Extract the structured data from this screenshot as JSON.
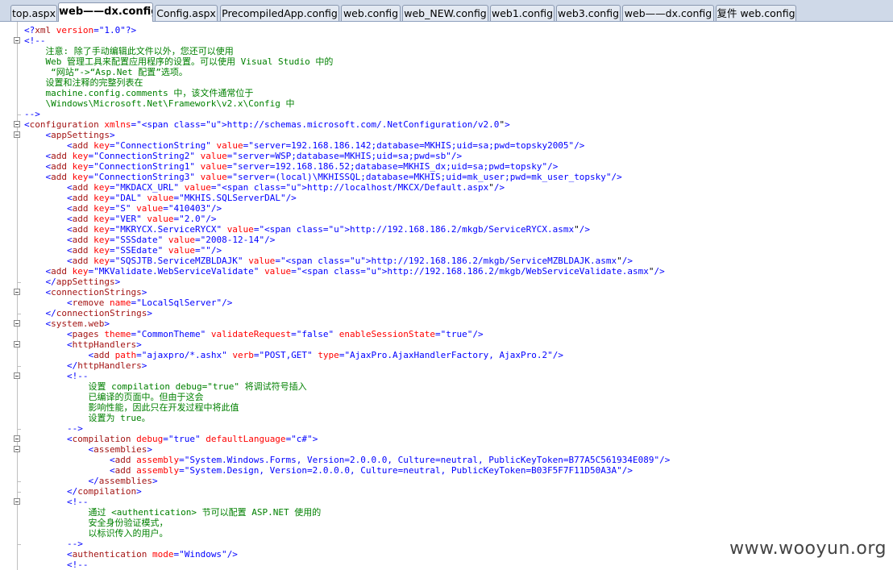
{
  "tabs": [
    {
      "label": "top.aspx",
      "active": false
    },
    {
      "label": "web——dx.config",
      "active": true
    },
    {
      "label": "Config.aspx",
      "active": false
    },
    {
      "label": "PrecompiledApp.config",
      "active": false
    },
    {
      "label": "web.config",
      "active": false
    },
    {
      "label": "web_NEW.config",
      "active": false
    },
    {
      "label": "web1.config",
      "active": false
    },
    {
      "label": "web3.config",
      "active": false
    },
    {
      "label": "web——dx.config",
      "active": false
    },
    {
      "label": "复件 web.config",
      "active": false
    }
  ],
  "code_lines": [
    "<?xml version=\"1.0\"?>",
    "<!--",
    "    注意: 除了手动编辑此文件以外，您还可以使用",
    "    Web 管理工具来配置应用程序的设置。可以使用 Visual Studio 中的",
    "     “网站”->“Asp.Net 配置”选项。",
    "    设置和注释的完整列表在",
    "    machine.config.comments 中，该文件通常位于",
    "    \\Windows\\Microsoft.Net\\Framework\\v2.x\\Config 中",
    "-->",
    "<configuration xmlns=\"http://schemas.microsoft.com/.NetConfiguration/v2.0\">",
    "    <appSettings>",
    "        <add key=\"ConnectionString\" value=\"server=192.168.186.142;database=MKHIS;uid=sa;pwd=topsky2005\"/>",
    "    <add key=\"ConnectionString2\" value=\"server=WSP;database=MKHIS;uid=sa;pwd=sb\"/>",
    "    <add key=\"ConnectionString1\" value=\"server=192.168.186.52;database=MKHIS_dx;uid=sa;pwd=topsky\"/>",
    "    <add key=\"ConnectionString3\" value=\"server=(local)\\MKHISSQL;database=MKHIS;uid=mk_user;pwd=mk_user_topsky\"/>",
    "        <add key=\"MKDACX_URL\" value=\"http://localhost/MKCX/Default.aspx\"/>",
    "        <add key=\"DAL\" value=\"MKHIS.SQLServerDAL\"/>",
    "        <add key=\"S\" value=\"410403\"/>",
    "        <add key=\"VER\" value=\"2.0\"/>",
    "        <add key=\"MKRYCX.ServiceRYCX\" value=\"http://192.168.186.2/mkgb/ServiceRYCX.asmx\"/>",
    "        <add key=\"SSSdate\" value=\"2008-12-14\"/>",
    "        <add key=\"SSEdate\" value=\"\"/>",
    "        <add key=\"SQSJTB.ServiceMZBLDAJK\" value=\"http://192.168.186.2/mkgb/ServiceMZBLDAJK.asmx\"/>",
    "    <add key=\"MKValidate.WebServiceValidate\" value=\"http://192.168.186.2/mkgb/WebServiceValidate.asmx\"/>",
    "    </appSettings>",
    "    <connectionStrings>",
    "        <remove name=\"LocalSqlServer\"/>",
    "    </connectionStrings>",
    "    <system.web>",
    "        <pages theme=\"CommonTheme\" validateRequest=\"false\" enableSessionState=\"true\"/>",
    "        <httpHandlers>",
    "            <add path=\"ajaxpro/*.ashx\" verb=\"POST,GET\" type=\"AjaxPro.AjaxHandlerFactory, AjaxPro.2\"/>",
    "        </httpHandlers>",
    "        <!--",
    "            设置 compilation debug=\"true\" 将调试符号插入",
    "            已编译的页面中。但由于这会",
    "            影响性能，因此只在开发过程中将此值",
    "            设置为 true。",
    "        -->",
    "        <compilation debug=\"true\" defaultLanguage=\"c#\">",
    "            <assemblies>",
    "                <add assembly=\"System.Windows.Forms, Version=2.0.0.0, Culture=neutral, PublicKeyToken=B77A5C561934E089\"/>",
    "                <add assembly=\"System.Design, Version=2.0.0.0, Culture=neutral, PublicKeyToken=B03F5F7F11D50A3A\"/>",
    "            </assemblies>",
    "        </compilation>",
    "        <!--",
    "            通过 <authentication> 节可以配置 ASP.NET 使用的",
    "            安全身份验证模式，",
    "            以标识传入的用户。",
    "        -->",
    "        <authentication mode=\"Windows\"/>",
    "        <!--"
  ],
  "watermark": "www.wooyun.org",
  "colors": {
    "bracket": "#0000ff",
    "tag": "#a31515",
    "attribute": "#ff0000",
    "value": "#0000ff",
    "comment": "#008000",
    "url": "#0000ff"
  }
}
